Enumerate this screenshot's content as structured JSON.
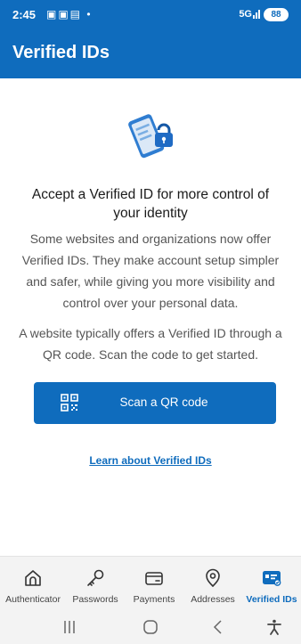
{
  "status_bar": {
    "time": "2:45",
    "network": "5G",
    "battery": "88"
  },
  "app_bar": {
    "title": "Verified IDs"
  },
  "content": {
    "heading": "Accept a Verified ID for more control of your identity",
    "description": "Some websites and organizations now offer Verified IDs. They make account setup simpler and safer, while giving you more visibility and control over your personal data.",
    "description2": "A website typically offers a Verified ID through a QR code. Scan the code to get started.",
    "scan_button_label": "Scan a QR code",
    "learn_link": "Learn about Verified IDs"
  },
  "bottom_nav": {
    "items": [
      {
        "label": "Authenticator",
        "icon": "authenticator-icon"
      },
      {
        "label": "Passwords",
        "icon": "key-icon"
      },
      {
        "label": "Payments",
        "icon": "card-icon"
      },
      {
        "label": "Addresses",
        "icon": "location-pin-icon"
      },
      {
        "label": "Verified IDs",
        "icon": "verified-id-icon",
        "active": true
      }
    ]
  },
  "colors": {
    "brand": "#0f6cbd",
    "text": "#1b1b1b",
    "muted": "#555555"
  }
}
